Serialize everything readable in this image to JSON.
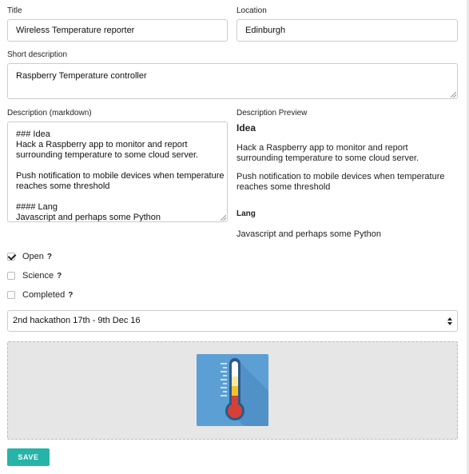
{
  "form": {
    "title_label": "Title",
    "title_value": "Wireless Temperature reporter",
    "location_label": "Location",
    "location_value": "Edinburgh",
    "short_label": "Short description",
    "short_value": "Raspberry Temperature controller",
    "desc_label": "Description (markdown)",
    "desc_lines": [
      "### Idea",
      "Hack a Raspberry app to monitor and report",
      "surrounding temperature to some cloud server.",
      "",
      "Push notification to mobile devices when temperature",
      "reaches some threshold",
      "",
      "#### Lang",
      "Javascript and perhaps some Python"
    ],
    "preview_label": "Description Preview",
    "preview": {
      "h_idea": "Idea",
      "p1": "Hack a Raspberry app to monitor and report surrounding temperature to some cloud server.",
      "p2": "Push notification to mobile devices when temperature reaches some threshold",
      "h_lang": "Lang",
      "p3": "Javascript and perhaps some Python"
    },
    "checkboxes": [
      {
        "label": "Open",
        "help": "?",
        "checked": true
      },
      {
        "label": "Science",
        "help": "?",
        "checked": false
      },
      {
        "label": "Completed",
        "help": "?",
        "checked": false
      }
    ],
    "event_select": "2nd hackathon 17th - 9th Dec 16",
    "image_icon": "thermometer-icon",
    "save_label": "SAVE"
  },
  "colors": {
    "accent": "#26b3a8",
    "image_bg": "#5b9fd4",
    "dropzone_bg": "#e6e6e6"
  }
}
